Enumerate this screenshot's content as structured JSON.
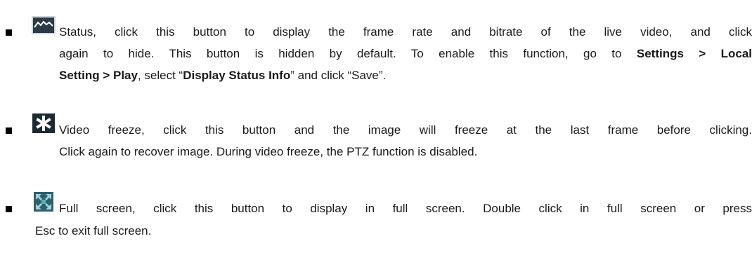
{
  "items": [
    {
      "icon": "status-chart-icon",
      "line1": "Status, click this button to display the frame rate and bitrate of the live video, and click",
      "line2_pre": "again to hide. This button is hidden by default. To enable this function, go to ",
      "line2_bold": "Settings > Local",
      "line3_bold1": "Setting > Play",
      "line3_mid1": ", select “",
      "line3_bold2": "Display Status Info",
      "line3_end": "” and click “Save”."
    },
    {
      "icon": "freeze-asterisk-icon",
      "line1": "Video freeze, click this button and the image will freeze at the last frame before clicking.",
      "line2": "Click again to recover image. During video freeze, the PTZ function is disabled."
    },
    {
      "icon": "fullscreen-arrows-icon",
      "line1": "Full screen, click this button to display in full screen. Double click in full screen or press",
      "line2": "Esc to exit full screen."
    }
  ],
  "colors": {
    "text": "#1a1a1a",
    "icon_dark": "#1e2a33",
    "icon_teal": "#3a8fa0"
  }
}
